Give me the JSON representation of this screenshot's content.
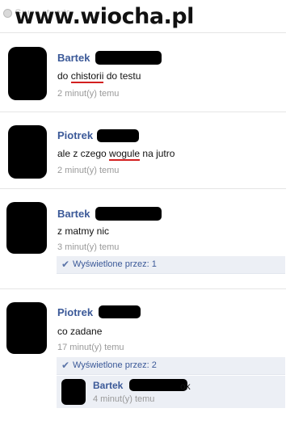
{
  "header": {
    "group_label": "Grupa otwarta",
    "watermark": "www.wiocha.pl"
  },
  "posts": [
    {
      "author": "Bartek",
      "text_before": "do ",
      "text_misspelled": "chistorii",
      "text_after": " do testu",
      "time": "2 minut(y) temu"
    },
    {
      "author": "Piotrek",
      "text_before": "ale z czego ",
      "text_misspelled": "wogule",
      "text_after": " na jutro",
      "time": "2 minut(y) temu"
    },
    {
      "author": "Bartek",
      "text": "z matmy nic",
      "time": "3 minut(y) temu",
      "seen": "Wyświetlone przez: 1"
    },
    {
      "author": "Piotrek",
      "text": "co zadane",
      "time": "17 minut(y) temu",
      "seen": "Wyświetlone przez: 2",
      "reply": {
        "author": "Bartek",
        "suffix": "ok",
        "time": "4 minut(y) temu"
      }
    }
  ],
  "colors": {
    "link_blue": "#3b5998",
    "spell_underline": "#d21f1f",
    "seen_bg": "#eceff5"
  }
}
